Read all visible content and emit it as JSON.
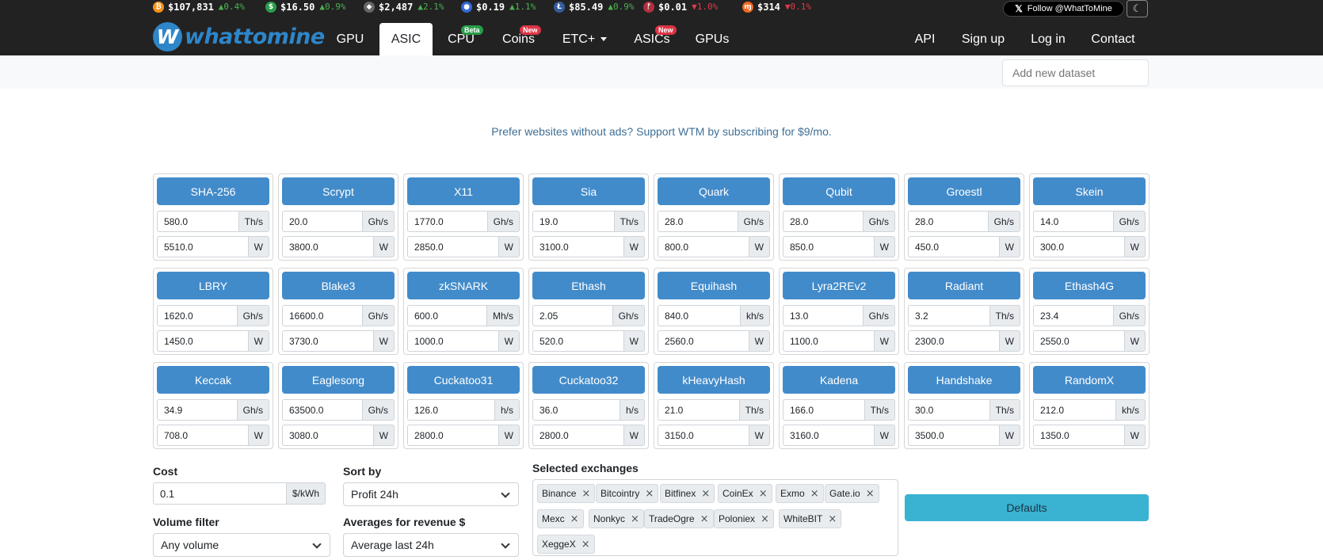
{
  "ticker": [
    {
      "icon": "bitcoin-icon",
      "glyph": "₿",
      "color": "#f7931a",
      "price": "$107,831",
      "dir": "up",
      "change": "0.4%"
    },
    {
      "icon": "bitcoin-cash-icon",
      "glyph": "$",
      "color": "#2a9d4a",
      "price": "$16.50",
      "dir": "up",
      "change": "0.9%"
    },
    {
      "icon": "ethereum-icon",
      "glyph": "◆",
      "color": "#666666",
      "price": "$2,487",
      "dir": "up",
      "change": "2.1%"
    },
    {
      "icon": "blue-coin-icon",
      "glyph": "●",
      "color": "#3468d6",
      "price": "$0.19",
      "dir": "up",
      "change": "1.1%"
    },
    {
      "icon": "litecoin-icon",
      "glyph": "Ł",
      "color": "#345d9d",
      "price": "$85.49",
      "dir": "up",
      "change": "0.9%"
    },
    {
      "icon": "red-coin-icon",
      "glyph": "ᚠ",
      "color": "#b03040",
      "price": "$0.01",
      "dir": "down",
      "change": "1.0%"
    },
    {
      "icon": "monero-icon",
      "glyph": "ɱ",
      "color": "#f26822",
      "price": "$314",
      "dir": "down",
      "change": "0.1%"
    }
  ],
  "follow_label": "Follow @WhatToMine",
  "logo_text": "whattomine",
  "nav": [
    {
      "label": "GPU",
      "badge": ""
    },
    {
      "label": "ASIC",
      "badge": "",
      "active": true
    },
    {
      "label": "CPU",
      "badge": "Beta"
    },
    {
      "label": "Coins",
      "badge": "New"
    },
    {
      "label": "ETC+",
      "badge": ""
    },
    {
      "label": "ASICs",
      "badge": "New"
    },
    {
      "label": "GPUs",
      "badge": ""
    },
    {
      "label": "API",
      "badge": ""
    },
    {
      "label": "Sign up",
      "badge": ""
    },
    {
      "label": "Log in",
      "badge": ""
    },
    {
      "label": "Contact",
      "badge": ""
    }
  ],
  "dataset_placeholder": "Add new dataset",
  "promo": "Prefer websites without ads? Support WTM by subscribing for $9/mo.",
  "algorithms": [
    {
      "name": "SHA-256",
      "hashrate": "580.0",
      "hash_unit": "Th/s",
      "power": "5510.0",
      "power_unit": "W"
    },
    {
      "name": "Scrypt",
      "hashrate": "20.0",
      "hash_unit": "Gh/s",
      "power": "3800.0",
      "power_unit": "W"
    },
    {
      "name": "X11",
      "hashrate": "1770.0",
      "hash_unit": "Gh/s",
      "power": "2850.0",
      "power_unit": "W"
    },
    {
      "name": "Sia",
      "hashrate": "19.0",
      "hash_unit": "Th/s",
      "power": "3100.0",
      "power_unit": "W"
    },
    {
      "name": "Quark",
      "hashrate": "28.0",
      "hash_unit": "Gh/s",
      "power": "800.0",
      "power_unit": "W"
    },
    {
      "name": "Qubit",
      "hashrate": "28.0",
      "hash_unit": "Gh/s",
      "power": "850.0",
      "power_unit": "W"
    },
    {
      "name": "Groestl",
      "hashrate": "28.0",
      "hash_unit": "Gh/s",
      "power": "450.0",
      "power_unit": "W"
    },
    {
      "name": "Skein",
      "hashrate": "14.0",
      "hash_unit": "Gh/s",
      "power": "300.0",
      "power_unit": "W"
    },
    {
      "name": "LBRY",
      "hashrate": "1620.0",
      "hash_unit": "Gh/s",
      "power": "1450.0",
      "power_unit": "W"
    },
    {
      "name": "Blake3",
      "hashrate": "16600.0",
      "hash_unit": "Gh/s",
      "power": "3730.0",
      "power_unit": "W"
    },
    {
      "name": "zkSNARK",
      "hashrate": "600.0",
      "hash_unit": "Mh/s",
      "power": "1000.0",
      "power_unit": "W"
    },
    {
      "name": "Ethash",
      "hashrate": "2.05",
      "hash_unit": "Gh/s",
      "power": "520.0",
      "power_unit": "W"
    },
    {
      "name": "Equihash",
      "hashrate": "840.0",
      "hash_unit": "kh/s",
      "power": "2560.0",
      "power_unit": "W"
    },
    {
      "name": "Lyra2REv2",
      "hashrate": "13.0",
      "hash_unit": "Gh/s",
      "power": "1100.0",
      "power_unit": "W"
    },
    {
      "name": "Radiant",
      "hashrate": "3.2",
      "hash_unit": "Th/s",
      "power": "2300.0",
      "power_unit": "W"
    },
    {
      "name": "Ethash4G",
      "hashrate": "23.4",
      "hash_unit": "Gh/s",
      "power": "2550.0",
      "power_unit": "W"
    },
    {
      "name": "Keccak",
      "hashrate": "34.9",
      "hash_unit": "Gh/s",
      "power": "708.0",
      "power_unit": "W"
    },
    {
      "name": "Eaglesong",
      "hashrate": "63500.0",
      "hash_unit": "Gh/s",
      "power": "3080.0",
      "power_unit": "W"
    },
    {
      "name": "Cuckatoo31",
      "hashrate": "126.0",
      "hash_unit": "h/s",
      "power": "2800.0",
      "power_unit": "W"
    },
    {
      "name": "Cuckatoo32",
      "hashrate": "36.0",
      "hash_unit": "h/s",
      "power": "2800.0",
      "power_unit": "W"
    },
    {
      "name": "kHeavyHash",
      "hashrate": "21.0",
      "hash_unit": "Th/s",
      "power": "3150.0",
      "power_unit": "W"
    },
    {
      "name": "Kadena",
      "hashrate": "166.0",
      "hash_unit": "Th/s",
      "power": "3160.0",
      "power_unit": "W"
    },
    {
      "name": "Handshake",
      "hashrate": "30.0",
      "hash_unit": "Th/s",
      "power": "3500.0",
      "power_unit": "W"
    },
    {
      "name": "RandomX",
      "hashrate": "212.0",
      "hash_unit": "kh/s",
      "power": "1350.0",
      "power_unit": "W"
    }
  ],
  "cost": {
    "label": "Cost",
    "value": "0.1",
    "unit": "$/kWh"
  },
  "sort": {
    "label": "Sort by",
    "value": "Profit 24h"
  },
  "volume": {
    "label": "Volume filter",
    "value": "Any volume"
  },
  "averages": {
    "label": "Averages for revenue $",
    "value": "Average last 24h"
  },
  "exchanges": {
    "label": "Selected exchanges",
    "items": [
      "Binance",
      "Bitcointry",
      "Bitfinex",
      "CoinEx",
      "Exmo",
      "Gate.io",
      "Mexc",
      "Nonkyc",
      "TradeOgre",
      "Poloniex",
      "WhiteBIT",
      "XeggeX"
    ]
  },
  "defaults_label": "Defaults"
}
